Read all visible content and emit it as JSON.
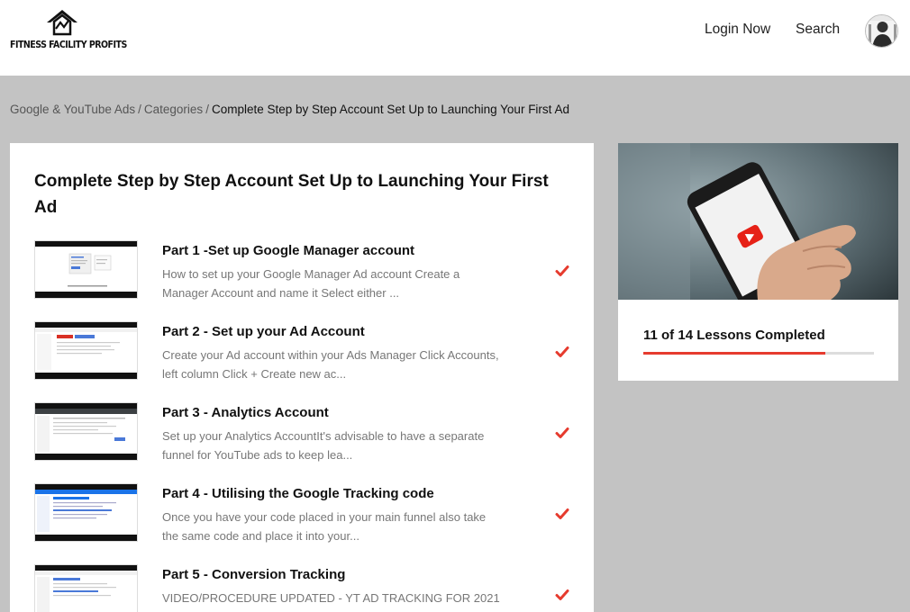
{
  "header": {
    "logo_text": "FITNESS FACILITY PROFITS",
    "nav": {
      "login_label": "Login Now",
      "search_label": "Search"
    }
  },
  "breadcrumb": {
    "items": [
      "Google & YouTube Ads",
      "Categories"
    ],
    "separator": "/",
    "current": "Complete Step by Step Account Set Up to Launching Your First Ad"
  },
  "course": {
    "title": "Complete Step by Step Account Set Up to Launching Your First Ad",
    "lessons": [
      {
        "title": "Part 1 -Set up Google Manager account",
        "description": "How to set up your Google Manager Ad account Create a Manager Account and name it Select either ...",
        "completed": true,
        "icon": "check-icon"
      },
      {
        "title": "Part 2 - Set up your Ad Account",
        "description": "Create your Ad account within your Ads Manager Click Accounts, left column Click + Create new ac...",
        "completed": true,
        "icon": "check-icon"
      },
      {
        "title": "Part 3 - Analytics Account",
        "description": "Set up your Analytics AccountIt's advisable to have a separate funnel for YouTube ads to keep lea...",
        "completed": true,
        "icon": "check-icon"
      },
      {
        "title": "Part 4 - Utilising the Google Tracking code",
        "description": "Once you have your code placed in your main funnel also take the same code and place it into your...",
        "completed": true,
        "icon": "check-icon"
      },
      {
        "title": "Part 5 - Conversion Tracking",
        "description": "VIDEO/PROCEDURE UPDATED - YT AD TRACKING FOR 2021",
        "completed": true,
        "icon": "check-icon"
      }
    ]
  },
  "progress": {
    "label": "11 of 14 Lessons Completed",
    "completed": 11,
    "total": 14,
    "fraction": 0.79
  },
  "colors": {
    "accent": "#e63b2e",
    "page_background": "#c3c3c3",
    "card_background": "#ffffff",
    "muted_text": "#777777"
  }
}
